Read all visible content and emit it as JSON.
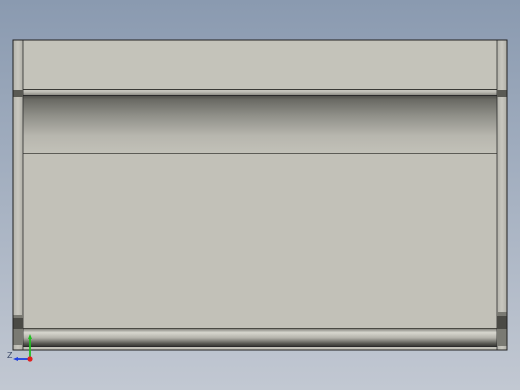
{
  "viewport": {
    "background_top": "#8a9ab0",
    "background_bottom": "#c2c8d2"
  },
  "model": {
    "face_color": "#c2c1b8",
    "edge_color": "#2b2b2b",
    "shadow_color": "#55554f"
  },
  "triad": {
    "axis_label_z": "Z",
    "x_color": "#e02020",
    "y_color": "#20c020",
    "z_color": "#2040e0"
  }
}
